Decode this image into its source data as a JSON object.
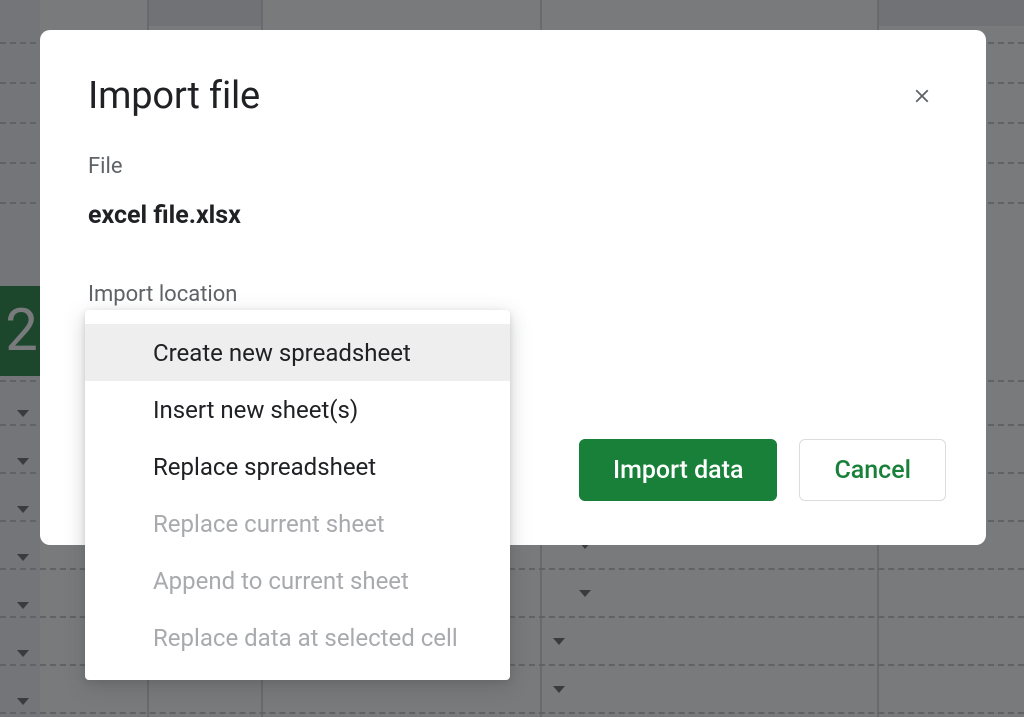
{
  "dialog": {
    "title": "Import file",
    "file_label": "File",
    "file_name": "excel file.xlsx",
    "location_label": "Import location",
    "import_button": "Import data",
    "cancel_button": "Cancel",
    "options": [
      {
        "label": "Create new spreadsheet",
        "state": "highlight"
      },
      {
        "label": "Insert new sheet(s)",
        "state": "normal"
      },
      {
        "label": "Replace spreadsheet",
        "state": "normal"
      },
      {
        "label": "Replace current sheet",
        "state": "disabled"
      },
      {
        "label": "Append to current sheet",
        "state": "disabled"
      },
      {
        "label": "Replace data at selected cell",
        "state": "disabled"
      }
    ]
  },
  "sheet": {
    "active_row_label": "2"
  },
  "colors": {
    "primary": "#188038"
  }
}
